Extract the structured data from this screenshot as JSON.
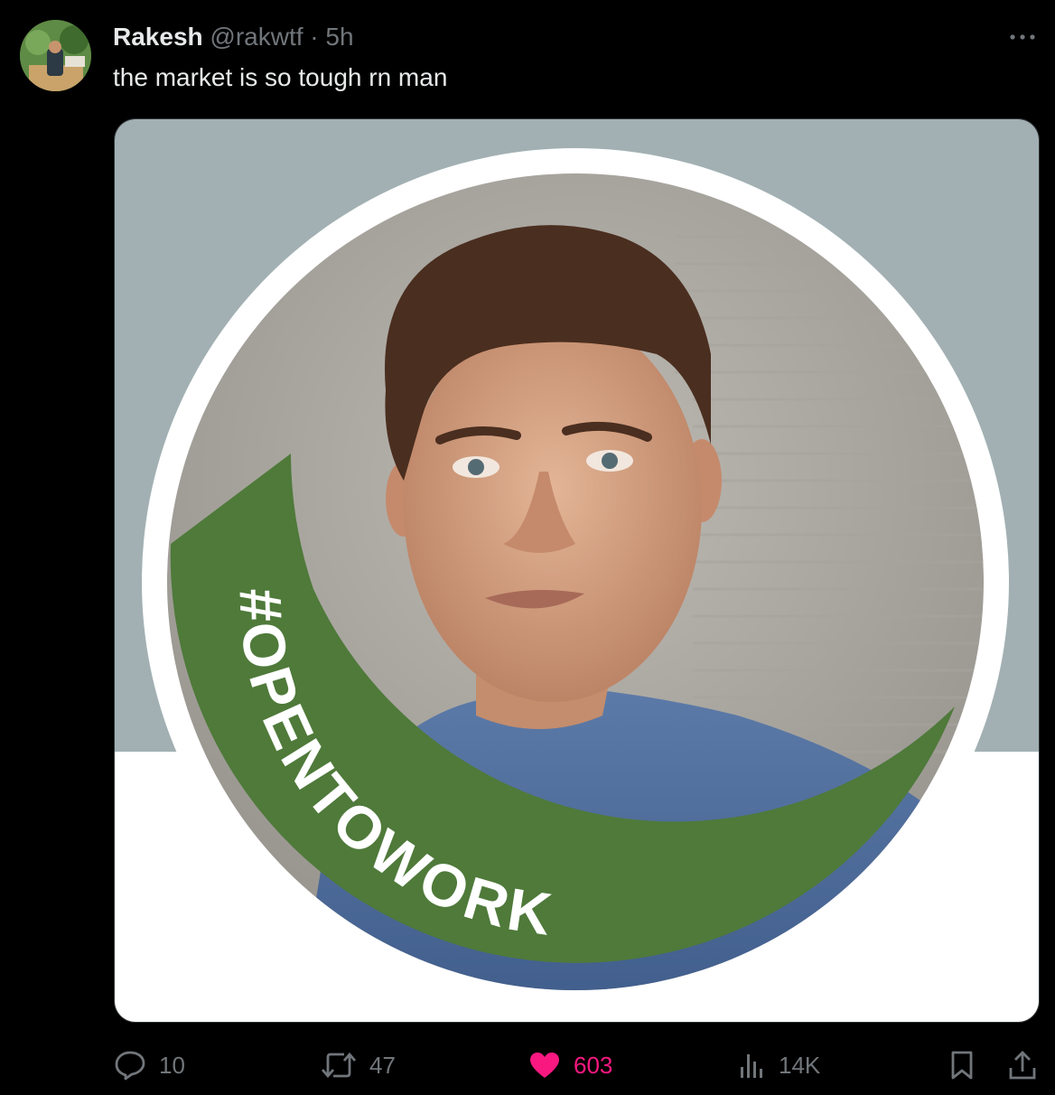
{
  "tweet": {
    "author_name": "Rakesh",
    "author_handle": "@rakwtf",
    "separator": "·",
    "time": "5h",
    "text": "the market is so tough rn man"
  },
  "media": {
    "badge_text": "#OPENTOWORK",
    "badge_color": "#4f7a3a",
    "background_top": "#a2b0b3",
    "background_bottom": "#ffffff"
  },
  "actions": {
    "reply_count": "10",
    "repost_count": "47",
    "like_count": "603",
    "views_count": "14K"
  },
  "icons": [
    "more-options-icon",
    "reply-icon",
    "repost-icon",
    "heart-icon",
    "views-icon",
    "bookmark-icon",
    "share-icon"
  ],
  "colors": {
    "background": "#000000",
    "text": "#e7e9ea",
    "muted": "#71767b",
    "like": "#f91880"
  }
}
